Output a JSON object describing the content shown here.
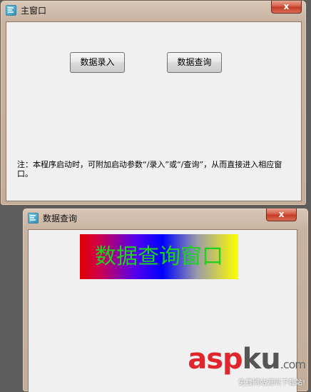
{
  "main_window": {
    "title": "主窗口",
    "close_glyph": "x",
    "buttons": {
      "entry_label": "数据录入",
      "query_label": "数据查询"
    },
    "note": "注：本程序启动时，可附加启动参数“/录入”或“/查询”，从而直接进入相应窗口。"
  },
  "query_window": {
    "title": "数据查询",
    "close_glyph": "x",
    "banner_text": "数据查询窗口"
  },
  "watermark": {
    "logo_asp": "asp",
    "logo_ku": "ku",
    "logo_com": ".com",
    "subtitle": "免费网站源码下载站!"
  },
  "icons": {
    "app_icon": "app-icon",
    "close_icon": "close-icon"
  }
}
